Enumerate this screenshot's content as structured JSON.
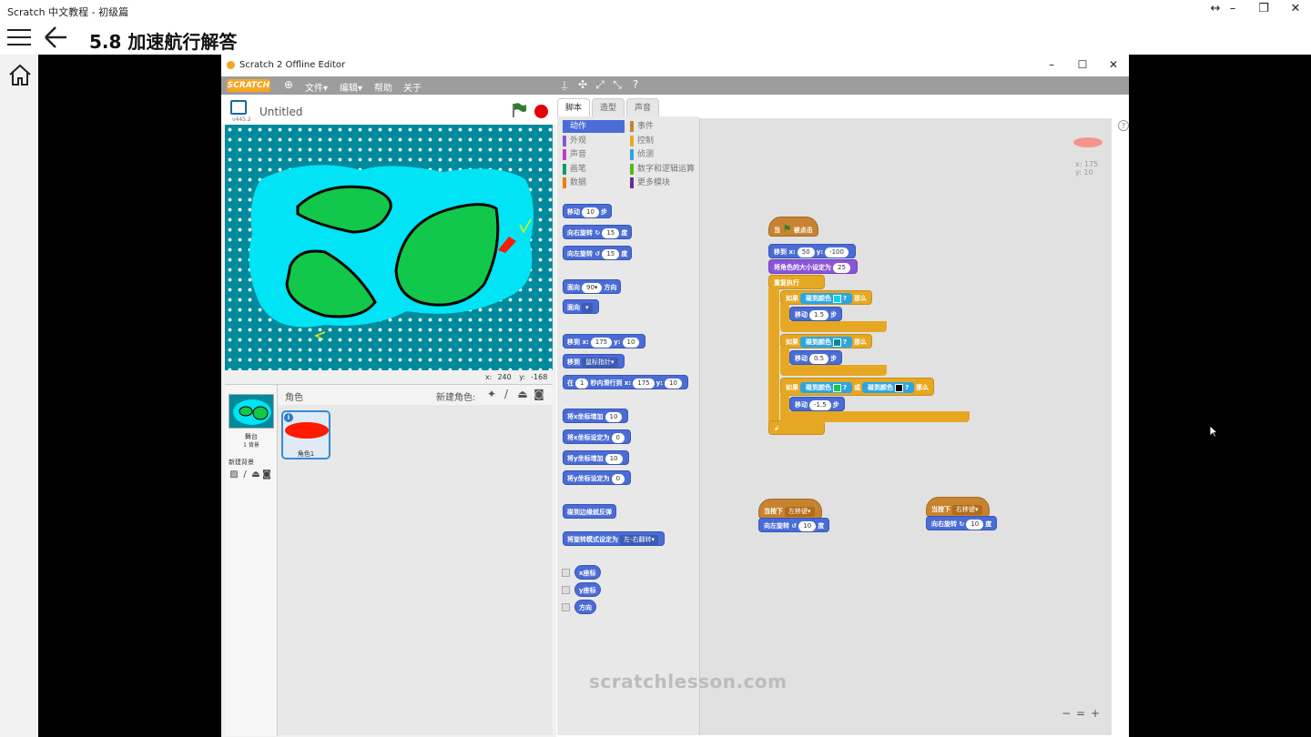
{
  "app": {
    "window_title": "Scratch 中文教程 - 初级篇",
    "lesson_title": "5.8  加速航行解答"
  },
  "scratch_window": {
    "title": "Scratch 2 Offline Editor",
    "logo": "SCRATCH",
    "menus": [
      "文件",
      "编辑",
      "帮助",
      "关于"
    ]
  },
  "stage": {
    "project_title": "Untitled",
    "version": "v445.2",
    "coords": {
      "x_label": "x:",
      "x": "240",
      "y_label": "y:",
      "y": "-168"
    }
  },
  "sprites": {
    "header": "角色",
    "new_sprite": "新建角色:",
    "stage_label": "舞台",
    "stage_bg_count": "1 背景",
    "new_backdrop": "新建背景",
    "sprite_name": "角色1",
    "sprite_info": "i"
  },
  "tabs": [
    "脚本",
    "造型",
    "声音"
  ],
  "categories": {
    "left": [
      {
        "label": "动作",
        "color": "#4a6cd4"
      },
      {
        "label": "外观",
        "color": "#8a55d7"
      },
      {
        "label": "声音",
        "color": "#bb42c3"
      },
      {
        "label": "画笔",
        "color": "#0e9a6c"
      },
      {
        "label": "数据",
        "color": "#ee7d16"
      }
    ],
    "right": [
      {
        "label": "事件",
        "color": "#c88330"
      },
      {
        "label": "控制",
        "color": "#e6a822"
      },
      {
        "label": "侦测",
        "color": "#2ca5e2"
      },
      {
        "label": "数字和逻辑运算",
        "color": "#5cb712"
      },
      {
        "label": "更多模块",
        "color": "#632d99"
      }
    ]
  },
  "palette": {
    "move": [
      "移动",
      "10",
      "步"
    ],
    "turn_right": [
      "向右旋转",
      "15",
      "度"
    ],
    "turn_left": [
      "向左旋转",
      "15",
      "度"
    ],
    "point_dir": [
      "面向",
      "90▾",
      "方向"
    ],
    "point_towards": [
      "面向",
      "▾"
    ],
    "goto_xy": [
      "移到",
      "x:",
      "175",
      "y:",
      "10"
    ],
    "goto": [
      "移到",
      "鼠标指针▾"
    ],
    "glide": [
      "在",
      "1",
      "秒内滑行到",
      "x:",
      "175",
      "y:",
      "10"
    ],
    "change_x": [
      "将x坐标增加",
      "10"
    ],
    "set_x": [
      "将x坐标设定为",
      "0"
    ],
    "change_y": [
      "将y坐标增加",
      "10"
    ],
    "set_y": [
      "将y坐标设定为",
      "0"
    ],
    "bounce": "碰到边缘就反弹",
    "rotation_style": [
      "将旋转模式设定为",
      "左-右翻转▾"
    ],
    "x_position": "x座标",
    "y_position": "y座标",
    "direction": "方向"
  },
  "script": {
    "when_flag": [
      "当",
      "被点击"
    ],
    "goto_xy": [
      "移到",
      "x:",
      "50",
      "y:",
      "-100"
    ],
    "set_size": [
      "将角色的大小设定为",
      "25"
    ],
    "forever": "重复执行",
    "if1": [
      "如果",
      "碰到颜色",
      "?",
      "那么"
    ],
    "move1": [
      "移动",
      "1.5",
      "步"
    ],
    "if2": [
      "如果",
      "碰到颜色",
      "?",
      "那么"
    ],
    "move2": [
      "移动",
      "0.5",
      "步"
    ],
    "if3": [
      "如果",
      "碰到颜色",
      "?",
      "或",
      "碰到颜色",
      "?",
      "那么"
    ],
    "move3": [
      "移动",
      "-1.5",
      "步"
    ],
    "forever_end": "↲",
    "key_left": [
      "当按下",
      "左移键▾"
    ],
    "turn_left": [
      "向左旋转",
      "10",
      "度"
    ],
    "key_right": [
      "当按下",
      "右移键▾"
    ],
    "turn_right": [
      "向右旋转",
      "10",
      "度"
    ]
  },
  "sprite_position": {
    "x_label": "x:",
    "x": "175",
    "y_label": "y:",
    "y": "10"
  },
  "watermark": "scratchlesson.com",
  "zoom": [
    "−",
    "=",
    "+"
  ],
  "colors": {
    "sea": "#008a9c",
    "water": "#00e4f6",
    "island": "#11c84a",
    "boat": "#ff1a00",
    "color_lightblue": "#00d9f0",
    "color_teal": "#008a9c",
    "color_green": "#11c84a",
    "color_black": "#000000"
  }
}
